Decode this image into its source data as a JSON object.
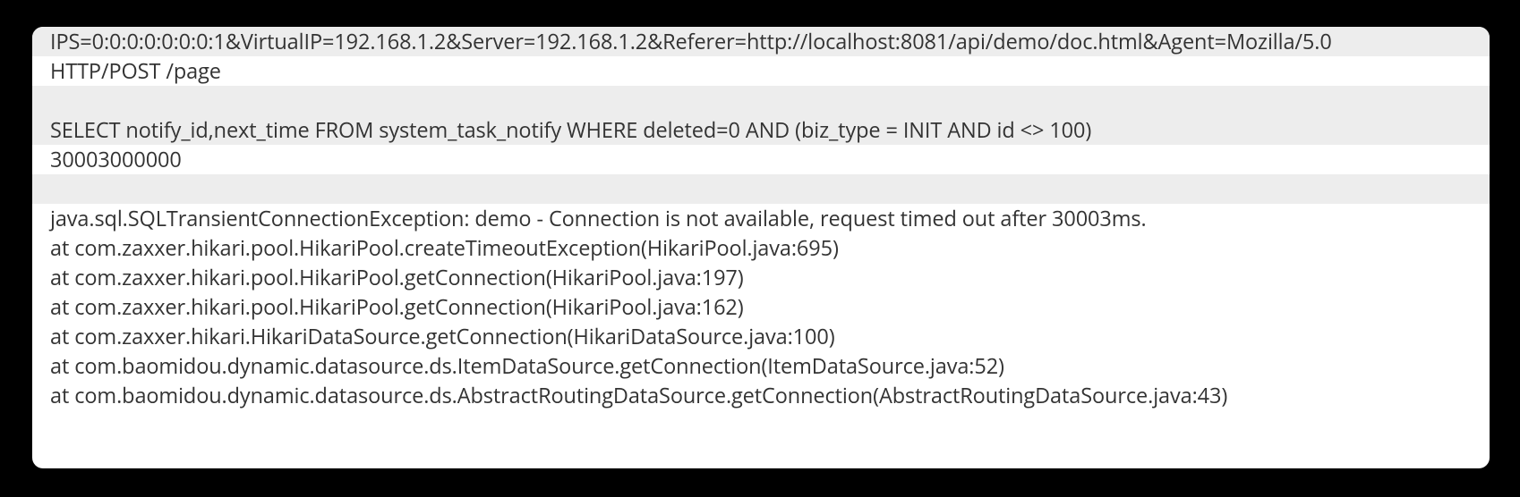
{
  "log": {
    "lines": [
      "IPS=0:0:0:0:0:0:0:1&VirtualIP=192.168.1.2&Server=192.168.1.2&Referer=http://localhost:8081/api/demo/doc.html&Agent=Mozilla/5.0",
      "HTTP/POST /page",
      "",
      "SELECT notify_id,next_time FROM system_task_notify WHERE deleted=0 AND (biz_type = INIT AND id <> 100)",
      "30003000000",
      "",
      "java.sql.SQLTransientConnectionException: demo - Connection is not available, request timed out after 30003ms.",
      "at com.zaxxer.hikari.pool.HikariPool.createTimeoutException(HikariPool.java:695)",
      "at com.zaxxer.hikari.pool.HikariPool.getConnection(HikariPool.java:197)",
      "at com.zaxxer.hikari.pool.HikariPool.getConnection(HikariPool.java:162)",
      "at com.zaxxer.hikari.HikariDataSource.getConnection(HikariDataSource.java:100)",
      "at com.baomidou.dynamic.datasource.ds.ItemDataSource.getConnection(ItemDataSource.java:52)",
      "at com.baomidou.dynamic.datasource.ds.AbstractRoutingDataSource.getConnection(AbstractRoutingDataSource.java:43)"
    ]
  }
}
